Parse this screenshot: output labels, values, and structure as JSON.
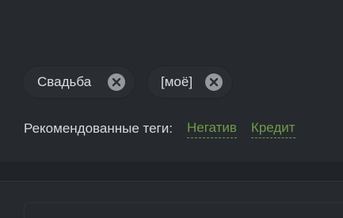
{
  "tags": [
    {
      "label": "Свадьба",
      "remove_icon": "close-circle-icon"
    },
    {
      "label": "[моё]",
      "remove_icon": "close-circle-icon"
    }
  ],
  "recommended": {
    "label": "Рекомендованные теги:",
    "suggestions": [
      "Негатив",
      "Кредит"
    ]
  },
  "colors": {
    "background": "#23272b",
    "panel": "#262a2e",
    "tag_background": "#2a2e33",
    "tag_text": "#dcdee0",
    "remove_icon": "#95999e",
    "suggestion": "#6f9a4a"
  }
}
